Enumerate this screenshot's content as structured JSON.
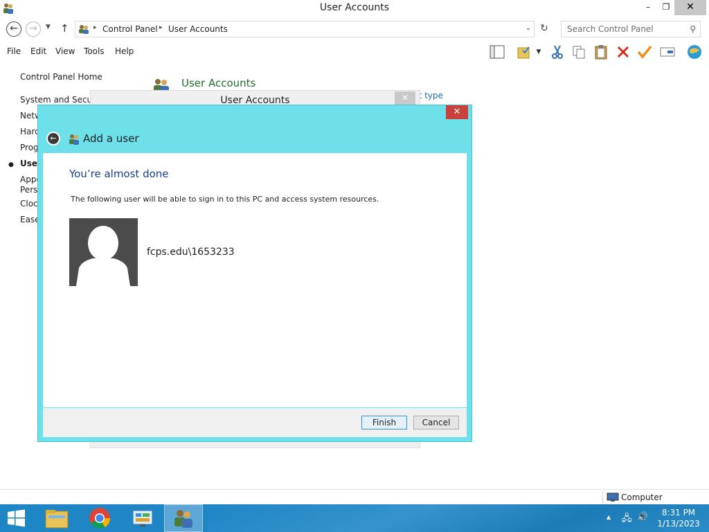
{
  "window": {
    "title": "User Accounts",
    "min_glyph": "–",
    "max_glyph": "❐",
    "close_glyph": "✕"
  },
  "nav": {
    "back_glyph": "←",
    "forward_glyph": "→",
    "recent_glyph": "▼",
    "up_glyph": "↑",
    "breadcrumb": [
      "Control Panel",
      "User Accounts"
    ],
    "sep_glyph": "▸",
    "dropdown_glyph": "⌄",
    "refresh_glyph": "↻",
    "search_placeholder": "Search Control Panel",
    "search_glyph": "⚲"
  },
  "menu": [
    "File",
    "Edit",
    "View",
    "Tools",
    "Help"
  ],
  "toolbar_icons": [
    "layout-icon",
    "folder-check-icon",
    "dropdown-icon",
    "cut-icon",
    "copy-icon",
    "paste-icon",
    "delete-icon",
    "checkmark-icon",
    "rename-icon",
    "globe-icon"
  ],
  "sidebar": {
    "home": "Control Panel Home",
    "items": [
      "System and Security",
      "Network and Internet",
      "Hardware and Sound",
      "Programs",
      "User Accounts",
      "Appearance and",
      "Personalization",
      "Clock, Language, and Region",
      "Ease of Access"
    ],
    "bullet": "●"
  },
  "main": {
    "heading": "User Accounts",
    "link_fragment": "nt type"
  },
  "bg_dialog": {
    "title": "User Accounts",
    "close_glyph": "✕"
  },
  "dialog": {
    "title": "Add a user",
    "close_glyph": "✕",
    "back_glyph": "←",
    "heading": "You’re almost done",
    "description": "The following user will be able to sign in to this PC and access system resources.",
    "username": "fcps.edu\\1653233",
    "finish_label": "Finish",
    "cancel_label": "Cancel"
  },
  "status": {
    "location": "Computer"
  },
  "taskbar": {
    "apps": [
      "start-icon",
      "file-explorer-icon",
      "chrome-icon",
      "control-panel-icon",
      "user-accounts-icon"
    ],
    "tray_up_glyph": "▲",
    "tray_net_glyph": "🖧",
    "tray_vol_glyph": "🔊",
    "time": "8:31 PM",
    "date": "1/13/2023"
  },
  "colors": {
    "dialog_frame": "#6ee0ea",
    "dialog_close": "#c8413c",
    "taskbar": "#1f86c6",
    "heading_blue": "#1a3e8c",
    "page_heading_green": "#1e6e2a"
  }
}
